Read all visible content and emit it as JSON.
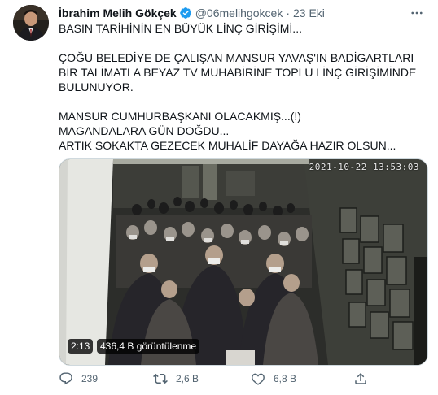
{
  "tweet": {
    "author_name": "İbrahim Melih Gökçek",
    "handle": "@06melihgokcek",
    "separator": "·",
    "date": "23 Eki",
    "text": "BASIN TARİHİNİN EN BÜYÜK LİNÇ GİRİŞİMİ...\n\nÇOĞU BELEDİYE DE ÇALIŞAN MANSUR YAVAŞ'IN BADİGARTLARI BİR TALİMATLA BEYAZ TV MUHABİRİNE TOPLU LİNÇ GİRİŞİMİNDE BULUNUYOR.\n\nMANSUR CUMHURBAŞKANI OLACAKMIŞ...(!)\nMAGANDALARA GÜN DOĞDU...\nARTIK SOKAKTA GEZECEK MUHALİF DAYAĞA HAZIR OLSUN...",
    "media": {
      "timestamp": "2021-10-22 13:53:03",
      "duration": "2:13",
      "views": "436,4 B görüntülenme"
    },
    "actions": {
      "replies": "239",
      "retweets": "2,6 B",
      "likes": "6,8 B"
    }
  },
  "icons": {
    "verified": "verified-badge-icon",
    "more": "more-dots-icon",
    "reply": "reply-icon",
    "retweet": "retweet-icon",
    "like": "heart-icon",
    "share": "share-icon"
  },
  "colors": {
    "verified": "#1d9bf0",
    "secondary_text": "#536471",
    "primary_text": "#0f1419"
  }
}
